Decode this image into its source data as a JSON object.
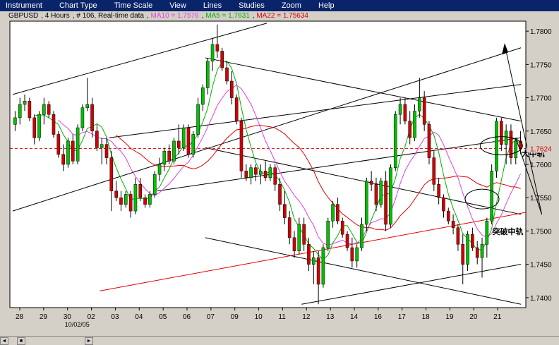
{
  "menu": [
    "Instrument",
    "Chart Type",
    "Time Scale",
    "View",
    "Lines",
    "Studies",
    "Zoom",
    "Help"
  ],
  "info": {
    "symbol": "GBPUSD",
    "period": ", 4 Hours",
    "bars": ", # 106, Real-time data",
    "ma10": "MA10 = 1.7576",
    "ma5": "MA5 = 1.7631",
    "ma22": "MA22 = 1.75634",
    "ma10_color": "#e040e0",
    "ma5_color": "#00b000",
    "ma22_color": "#e00000"
  },
  "annotations": {
    "upper": "大中轨",
    "lower": "突破中轨"
  },
  "chart_data": {
    "type": "candlestick",
    "title": "",
    "ylim": [
      1.7385,
      1.7815
    ],
    "y_ticks": [
      1.74,
      1.745,
      1.75,
      1.755,
      1.76,
      1.765,
      1.77,
      1.775,
      1.78
    ],
    "y_tick_labels": [
      "1.7400",
      "1.7450",
      "1.7500",
      "1.7550",
      "1.7600",
      "1.7650",
      "1.7700",
      "1.7750",
      "1.7800"
    ],
    "current_price": 1.7624,
    "current_price_label": "1.7624",
    "x_labels": [
      "28",
      "29",
      "30",
      "02",
      "03",
      "04",
      "05",
      "06",
      "07",
      "09",
      "10",
      "11",
      "12",
      "13",
      "14",
      "16",
      "17",
      "18",
      "19",
      "20",
      "21"
    ],
    "x_sublabel": "10/02/05",
    "candles": [
      [
        1.766,
        1.768,
        1.765,
        1.767
      ],
      [
        1.767,
        1.77,
        1.766,
        1.769
      ],
      [
        1.769,
        1.7705,
        1.768,
        1.7695
      ],
      [
        1.7695,
        1.77,
        1.7665,
        1.767
      ],
      [
        1.767,
        1.7675,
        1.763,
        1.764
      ],
      [
        1.764,
        1.768,
        1.7635,
        1.7675
      ],
      [
        1.7675,
        1.77,
        1.766,
        1.769
      ],
      [
        1.769,
        1.7695,
        1.767,
        1.7675
      ],
      [
        1.7675,
        1.768,
        1.764,
        1.7645
      ],
      [
        1.7645,
        1.765,
        1.761,
        1.7615
      ],
      [
        1.7615,
        1.763,
        1.759,
        1.76
      ],
      [
        1.76,
        1.764,
        1.7595,
        1.7635
      ],
      [
        1.7635,
        1.7645,
        1.76,
        1.7605
      ],
      [
        1.7605,
        1.766,
        1.76,
        1.7655
      ],
      [
        1.7655,
        1.769,
        1.765,
        1.7685
      ],
      [
        1.7685,
        1.773,
        1.768,
        1.769
      ],
      [
        1.769,
        1.77,
        1.764,
        1.765
      ],
      [
        1.765,
        1.766,
        1.762,
        1.7625
      ],
      [
        1.7625,
        1.764,
        1.76,
        1.763
      ],
      [
        1.763,
        1.764,
        1.76,
        1.761
      ],
      [
        1.761,
        1.762,
        1.753,
        1.756
      ],
      [
        1.756,
        1.7575,
        1.7545,
        1.755
      ],
      [
        1.755,
        1.756,
        1.753,
        1.754
      ],
      [
        1.754,
        1.756,
        1.7535,
        1.7555
      ],
      [
        1.7555,
        1.756,
        1.752,
        1.753
      ],
      [
        1.753,
        1.758,
        1.7525,
        1.757
      ],
      [
        1.757,
        1.758,
        1.7545,
        1.755
      ],
      [
        1.755,
        1.7555,
        1.7535,
        1.754
      ],
      [
        1.754,
        1.756,
        1.7535,
        1.7555
      ],
      [
        1.7555,
        1.759,
        1.755,
        1.7585
      ],
      [
        1.7585,
        1.761,
        1.7575,
        1.76
      ],
      [
        1.76,
        1.7625,
        1.759,
        1.762
      ],
      [
        1.762,
        1.763,
        1.76,
        1.7605
      ],
      [
        1.7605,
        1.764,
        1.76,
        1.7635
      ],
      [
        1.7635,
        1.766,
        1.7615,
        1.7625
      ],
      [
        1.7625,
        1.766,
        1.762,
        1.7655
      ],
      [
        1.7655,
        1.766,
        1.761,
        1.7615
      ],
      [
        1.7615,
        1.765,
        1.761,
        1.7645
      ],
      [
        1.7645,
        1.77,
        1.764,
        1.769
      ],
      [
        1.769,
        1.772,
        1.768,
        1.7715
      ],
      [
        1.7715,
        1.776,
        1.7705,
        1.7755
      ],
      [
        1.7755,
        1.779,
        1.774,
        1.778
      ],
      [
        1.778,
        1.781,
        1.776,
        1.777
      ],
      [
        1.777,
        1.7775,
        1.774,
        1.7745
      ],
      [
        1.7745,
        1.7755,
        1.772,
        1.7725
      ],
      [
        1.7725,
        1.774,
        1.769,
        1.77
      ],
      [
        1.77,
        1.7705,
        1.766,
        1.7665
      ],
      [
        1.7665,
        1.767,
        1.758,
        1.759
      ],
      [
        1.759,
        1.76,
        1.7575,
        1.758
      ],
      [
        1.758,
        1.76,
        1.757,
        1.7595
      ],
      [
        1.7595,
        1.76,
        1.7575,
        1.7585
      ],
      [
        1.7585,
        1.76,
        1.757,
        1.759
      ],
      [
        1.759,
        1.7605,
        1.7575,
        1.758
      ],
      [
        1.758,
        1.76,
        1.7575,
        1.7595
      ],
      [
        1.7595,
        1.76,
        1.756,
        1.757
      ],
      [
        1.757,
        1.758,
        1.753,
        1.754
      ],
      [
        1.754,
        1.756,
        1.751,
        1.752
      ],
      [
        1.752,
        1.753,
        1.748,
        1.749
      ],
      [
        1.749,
        1.75,
        1.746,
        1.747
      ],
      [
        1.747,
        1.752,
        1.7465,
        1.751
      ],
      [
        1.751,
        1.752,
        1.747,
        1.748
      ],
      [
        1.748,
        1.749,
        1.744,
        1.745
      ],
      [
        1.745,
        1.747,
        1.742,
        1.746
      ],
      [
        1.746,
        1.747,
        1.739,
        1.742
      ],
      [
        1.742,
        1.748,
        1.7415,
        1.7475
      ],
      [
        1.7475,
        1.752,
        1.747,
        1.7515
      ],
      [
        1.7515,
        1.7545,
        1.7505,
        1.754
      ],
      [
        1.754,
        1.755,
        1.751,
        1.7515
      ],
      [
        1.7515,
        1.752,
        1.749,
        1.7495
      ],
      [
        1.7495,
        1.75,
        1.747,
        1.7475
      ],
      [
        1.7475,
        1.749,
        1.7445,
        1.7455
      ],
      [
        1.7455,
        1.748,
        1.7445,
        1.7475
      ],
      [
        1.7475,
        1.752,
        1.747,
        1.751
      ],
      [
        1.751,
        1.758,
        1.75,
        1.7575
      ],
      [
        1.7575,
        1.759,
        1.756,
        1.757
      ],
      [
        1.757,
        1.758,
        1.753,
        1.754
      ],
      [
        1.754,
        1.758,
        1.7535,
        1.7575
      ],
      [
        1.7575,
        1.759,
        1.75,
        1.751
      ],
      [
        1.751,
        1.76,
        1.7505,
        1.7595
      ],
      [
        1.7595,
        1.768,
        1.759,
        1.7675
      ],
      [
        1.7675,
        1.77,
        1.766,
        1.769
      ],
      [
        1.769,
        1.77,
        1.766,
        1.7665
      ],
      [
        1.7665,
        1.768,
        1.763,
        1.764
      ],
      [
        1.764,
        1.769,
        1.7635,
        1.768
      ],
      [
        1.768,
        1.773,
        1.767,
        1.77
      ],
      [
        1.77,
        1.771,
        1.765,
        1.766
      ],
      [
        1.766,
        1.7665,
        1.76,
        1.761
      ],
      [
        1.761,
        1.762,
        1.756,
        1.757
      ],
      [
        1.757,
        1.758,
        1.754,
        1.755
      ],
      [
        1.755,
        1.7555,
        1.752,
        1.753
      ],
      [
        1.753,
        1.7535,
        1.751,
        1.7515
      ],
      [
        1.7515,
        1.7525,
        1.7495,
        1.7505
      ],
      [
        1.7505,
        1.751,
        1.747,
        1.748
      ],
      [
        1.748,
        1.7495,
        1.742,
        1.745
      ],
      [
        1.745,
        1.75,
        1.744,
        1.7495
      ],
      [
        1.7495,
        1.7505,
        1.747,
        1.7475
      ],
      [
        1.7475,
        1.7485,
        1.745,
        1.746
      ],
      [
        1.746,
        1.749,
        1.743,
        1.748
      ],
      [
        1.748,
        1.752,
        1.746,
        1.7515
      ],
      [
        1.7515,
        1.76,
        1.751,
        1.759
      ],
      [
        1.759,
        1.767,
        1.758,
        1.7665
      ],
      [
        1.7665,
        1.767,
        1.762,
        1.763
      ],
      [
        1.763,
        1.766,
        1.76,
        1.765
      ],
      [
        1.765,
        1.766,
        1.76,
        1.761
      ],
      [
        1.761,
        1.764,
        1.76,
        1.7635
      ],
      [
        1.7635,
        1.765,
        1.7615,
        1.7624
      ]
    ],
    "ma5_color": "#00b000",
    "ma10_color": "#e040e0",
    "ma22_color": "#e00000",
    "channel_color": "#000000",
    "trend_color": "#e00000",
    "grid": false
  }
}
